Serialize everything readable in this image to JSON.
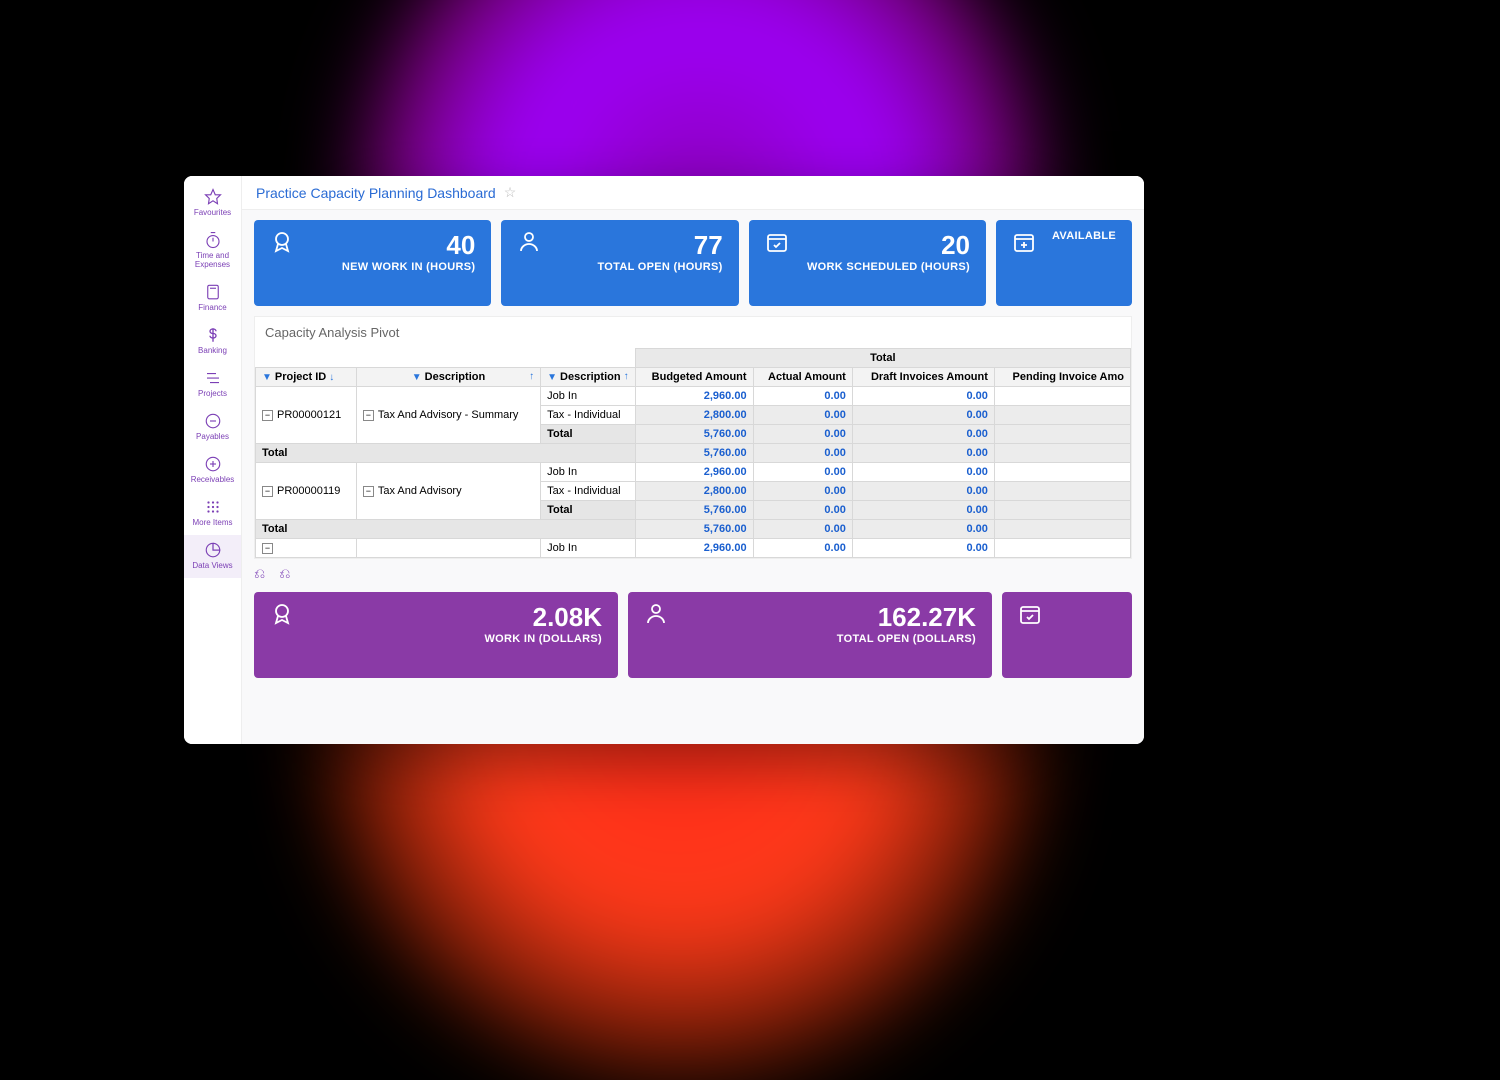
{
  "page": {
    "title": "Practice Capacity Planning Dashboard"
  },
  "sidebar": {
    "items": [
      {
        "label": "Favourites",
        "icon": "star"
      },
      {
        "label": "Time and Expenses",
        "icon": "stopwatch"
      },
      {
        "label": "Finance",
        "icon": "calculator"
      },
      {
        "label": "Banking",
        "icon": "dollar"
      },
      {
        "label": "Projects",
        "icon": "tasks"
      },
      {
        "label": "Payables",
        "icon": "minus-circle"
      },
      {
        "label": "Receivables",
        "icon": "plus-circle"
      },
      {
        "label": "More Items",
        "icon": "grid"
      },
      {
        "label": "Data Views",
        "icon": "pie"
      }
    ],
    "active": "Data Views"
  },
  "kpi_top": [
    {
      "value": "40",
      "label": "NEW WORK IN (HOURS)",
      "icon": "ribbon"
    },
    {
      "value": "77",
      "label": "TOTAL OPEN (HOURS)",
      "icon": "person"
    },
    {
      "value": "20",
      "label": "WORK SCHEDULED (HOURS)",
      "icon": "calendar-check"
    },
    {
      "value": "",
      "label": "AVAILABLE",
      "icon": "calendar-plus"
    }
  ],
  "pivot": {
    "title": "Capacity Analysis Pivot",
    "banner": "Total",
    "columns": {
      "project_id": "Project ID",
      "description": "Description",
      "description2": "Description",
      "budgeted": "Budgeted Amount",
      "actual": "Actual Amount",
      "draft": "Draft Invoices Amount",
      "pending": "Pending Invoice Amo"
    },
    "rows": [
      {
        "project_id": "PR00000121",
        "description": "Tax And Advisory - Summary",
        "lines": [
          {
            "d2": "Job In",
            "budgeted": "2,960.00",
            "actual": "0.00",
            "draft": "0.00"
          },
          {
            "d2": "Tax - Individual",
            "budgeted": "2,800.00",
            "actual": "0.00",
            "draft": "0.00"
          },
          {
            "d2": "Total",
            "budgeted": "5,760.00",
            "actual": "0.00",
            "draft": "0.00"
          }
        ],
        "group_total": {
          "d2": "Total",
          "budgeted": "5,760.00",
          "actual": "0.00",
          "draft": "0.00"
        }
      },
      {
        "project_id": "PR00000119",
        "description": "Tax And Advisory",
        "lines": [
          {
            "d2": "Job In",
            "budgeted": "2,960.00",
            "actual": "0.00",
            "draft": "0.00"
          },
          {
            "d2": "Tax - Individual",
            "budgeted": "2,800.00",
            "actual": "0.00",
            "draft": "0.00"
          },
          {
            "d2": "Total",
            "budgeted": "5,760.00",
            "actual": "0.00",
            "draft": "0.00"
          }
        ],
        "group_total": {
          "d2": "Total",
          "budgeted": "5,760.00",
          "actual": "0.00",
          "draft": "0.00"
        }
      },
      {
        "project_id": "",
        "description": "",
        "lines": [
          {
            "d2": "Job In",
            "budgeted": "2,960.00",
            "actual": "0.00",
            "draft": "0.00"
          }
        ]
      }
    ]
  },
  "kpi_bottom": [
    {
      "value": "2.08K",
      "label": "WORK IN (DOLLARS)",
      "icon": "ribbon"
    },
    {
      "value": "162.27K",
      "label": "TOTAL OPEN (DOLLARS)",
      "icon": "person"
    },
    {
      "value": "",
      "label": "",
      "icon": "calendar-check"
    }
  ]
}
